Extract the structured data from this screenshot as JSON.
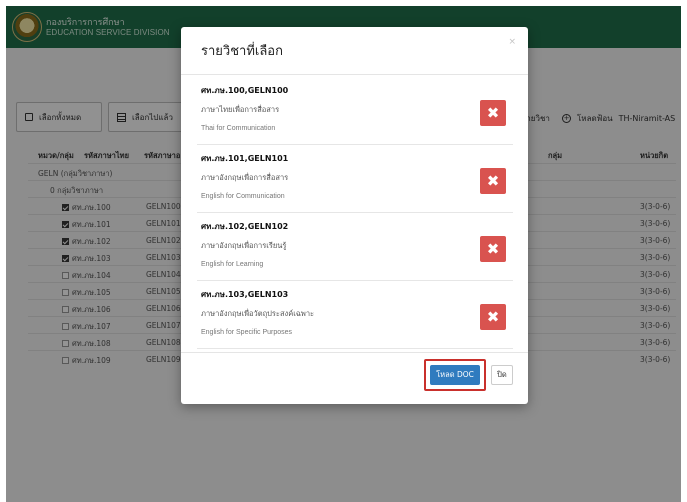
{
  "header": {
    "org_th": "กองบริการการศึกษา",
    "org_en": "EDUCATION SERVICE DIVISION"
  },
  "toolbar": {
    "select_all": "เลือกทั้งหมด",
    "selected": "เลือกไปแล้ว",
    "course_list": "รายวิชา",
    "download_label": "โหลดฟ้อน",
    "font_name": "TH-Niramit-AS"
  },
  "table": {
    "headers": {
      "category": "หมวด/กลุ่ม",
      "code_th": "รหัสภาษาไทย",
      "code_en": "รหัสภาษาอ",
      "group": "กลุ่ม",
      "credits": "หน่วยกิต"
    },
    "group_row": "GELN (กลุ่มวิชาภาษา)",
    "subgroup_row": "0 กลุ่มวิชาภาษา",
    "rows": [
      {
        "code_th": "ศท.ภษ.100",
        "code_en": "GELN100",
        "credits": "3(3-0-6)",
        "checked": true
      },
      {
        "code_th": "ศท.ภษ.101",
        "code_en": "GELN101",
        "credits": "3(3-0-6)",
        "checked": true
      },
      {
        "code_th": "ศท.ภษ.102",
        "code_en": "GELN102",
        "credits": "3(3-0-6)",
        "checked": true
      },
      {
        "code_th": "ศท.ภษ.103",
        "code_en": "GELN103",
        "credits": "3(3-0-6)",
        "checked": true
      },
      {
        "code_th": "ศท.ภษ.104",
        "code_en": "GELN104",
        "credits": "3(3-0-6)",
        "checked": false
      },
      {
        "code_th": "ศท.ภษ.105",
        "code_en": "GELN105",
        "credits": "3(3-0-6)",
        "checked": false
      },
      {
        "code_th": "ศท.ภษ.106",
        "code_en": "GELN106",
        "credits": "3(3-0-6)",
        "checked": false
      },
      {
        "code_th": "ศท.ภษ.107",
        "code_en": "GELN107",
        "credits": "3(3-0-6)",
        "checked": false
      },
      {
        "code_th": "ศท.ภษ.108",
        "code_en": "GELN108",
        "credits": "3(3-0-6)",
        "checked": false
      },
      {
        "code_th": "ศท.ภษ.109",
        "code_en": "GELN109",
        "credits": "3(3-0-6)",
        "checked": false
      }
    ]
  },
  "modal": {
    "title": "รายวิชาที่เลือก",
    "close_glyph": "×",
    "courses": [
      {
        "code": "ศท.ภษ.100,GELN100",
        "name_th": "ภาษาไทยเพื่อการสื่อสาร",
        "name_en": "Thai for Communication"
      },
      {
        "code": "ศท.ภษ.101,GELN101",
        "name_th": "ภาษาอังกฤษเพื่อการสื่อสาร",
        "name_en": "English for Communication"
      },
      {
        "code": "ศท.ภษ.102,GELN102",
        "name_th": "ภาษาอังกฤษเพื่อการเรียนรู้",
        "name_en": "English for Learning"
      },
      {
        "code": "ศท.ภษ.103,GELN103",
        "name_th": "ภาษาอังกฤษเพื่อวัตถุประสงค์เฉพาะ",
        "name_en": "English for Specific Purposes"
      }
    ],
    "remove_glyph": "✖",
    "download_button": "โหลด DOC",
    "close_button": "ปิด"
  },
  "colors": {
    "header_green": "#1f6f4a",
    "remove_red": "#d9534f",
    "download_blue": "#2f7bbf",
    "highlight_red": "#c9302c"
  }
}
